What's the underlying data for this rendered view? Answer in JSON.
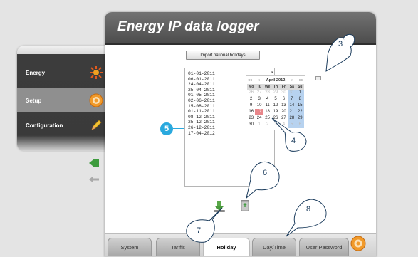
{
  "app": {
    "title": "Energy IP data logger"
  },
  "sidebar": {
    "items": [
      {
        "label": "Energy",
        "icon": "energy-icon",
        "active": false
      },
      {
        "label": "Setup",
        "icon": "gear-icon",
        "active": true
      },
      {
        "label": "Configuration",
        "icon": "pencil-icon",
        "active": false
      }
    ]
  },
  "toolbar": {
    "import_label": "Import national holidays"
  },
  "holidays": {
    "dates": [
      "01-01-2011",
      "06-01-2011",
      "24-04-2011",
      "25-04-2011",
      "01-05-2011",
      "02-06-2011",
      "15-08-2011",
      "01-11-2011",
      "08-12-2011",
      "25-12-2011",
      "26-12-2011",
      "17-04-2012"
    ]
  },
  "calendar": {
    "nav_prev_year": "««",
    "nav_prev": "‹",
    "month": "April 2012",
    "nav_next": "›",
    "nav_next_year": "»»",
    "weekdays": [
      "Mo",
      "Tu",
      "We",
      "Th",
      "Fr",
      "Sa",
      "Su"
    ],
    "weeks": [
      [
        "26",
        "27",
        "28",
        "29",
        "30",
        "31",
        "1"
      ],
      [
        "2",
        "3",
        "4",
        "5",
        "6",
        "7",
        "8"
      ],
      [
        "9",
        "10",
        "11",
        "12",
        "13",
        "14",
        "15"
      ],
      [
        "16",
        "17",
        "18",
        "19",
        "20",
        "21",
        "22"
      ],
      [
        "23",
        "24",
        "25",
        "26",
        "27",
        "28",
        "29"
      ],
      [
        "30",
        "1",
        "2",
        "3",
        "4",
        "5",
        "6"
      ]
    ],
    "selected": "17"
  },
  "tabs": [
    {
      "label": "System",
      "active": false
    },
    {
      "label": "Tariffs",
      "active": false
    },
    {
      "label": "Holiday",
      "active": true
    },
    {
      "label": "Day/Time",
      "active": false
    },
    {
      "label": "User Password",
      "active": false
    }
  ],
  "callouts": {
    "c3": "3",
    "c4": "4",
    "c5": "5",
    "c6": "6",
    "c7": "7",
    "c8": "8"
  },
  "colors": {
    "badge": "#2aa9de",
    "weekend": "#b7d2ef",
    "selected_day": "#e8868a"
  }
}
